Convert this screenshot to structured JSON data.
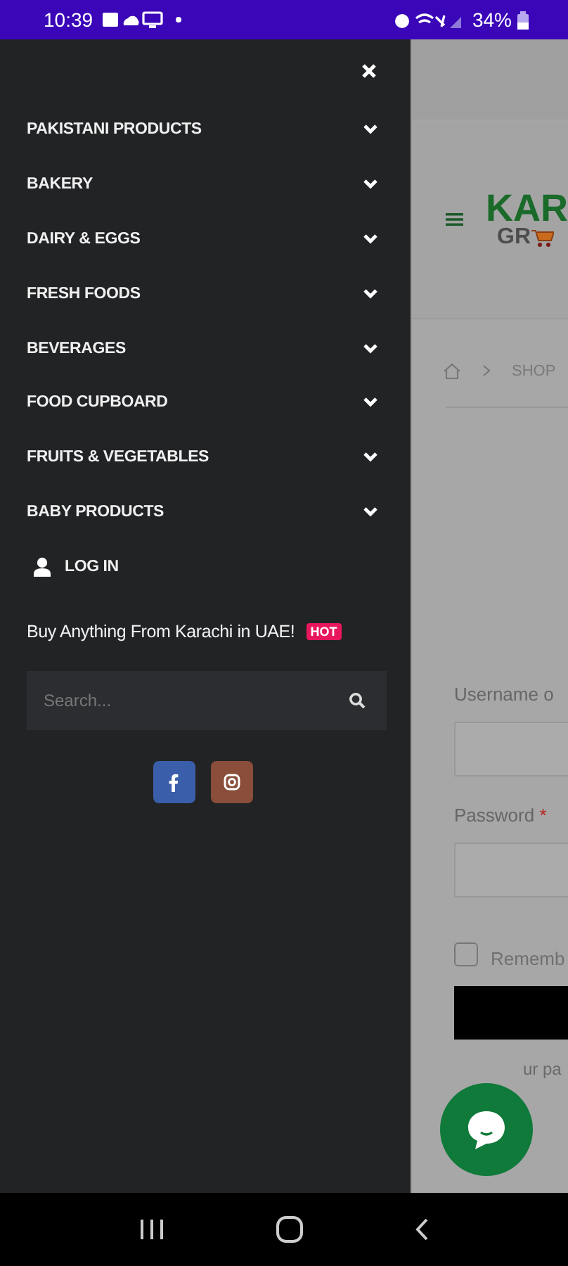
{
  "status_bar": {
    "time": "10:39",
    "battery": "34%"
  },
  "drawer": {
    "menu_items": [
      {
        "label": "PAKISTANI PRODUCTS",
        "expanded": false
      },
      {
        "label": "BAKERY",
        "expanded": false
      },
      {
        "label": "DAIRY & EGGS",
        "expanded": false
      },
      {
        "label": "FRESH FOODS",
        "expanded": false
      },
      {
        "label": "BEVERAGES",
        "expanded": false
      },
      {
        "label": "FOOD CUPBOARD",
        "expanded": false
      },
      {
        "label": "FRUITS & VEGETABLES",
        "expanded": false
      },
      {
        "label": "BABY PRODUCTS",
        "expanded": false
      }
    ],
    "login": {
      "label": "LOG IN"
    },
    "promo": {
      "text": "Buy Anything From Karachi in UAE!",
      "badge": "HOT"
    },
    "search": {
      "placeholder": "Search..."
    },
    "social": [
      {
        "kind": "facebook"
      },
      {
        "kind": "instagram"
      }
    ]
  },
  "page": {
    "logo": {
      "line_1": "KAR",
      "line_2": "GR"
    },
    "breadcrumb": {
      "current": "SHOP"
    },
    "form": {
      "username_label": "Username o",
      "password_label": "Password",
      "required_mark": "*",
      "remember": {
        "label": "Rememb",
        "checked": false
      },
      "lost_password": "ur pa"
    }
  }
}
